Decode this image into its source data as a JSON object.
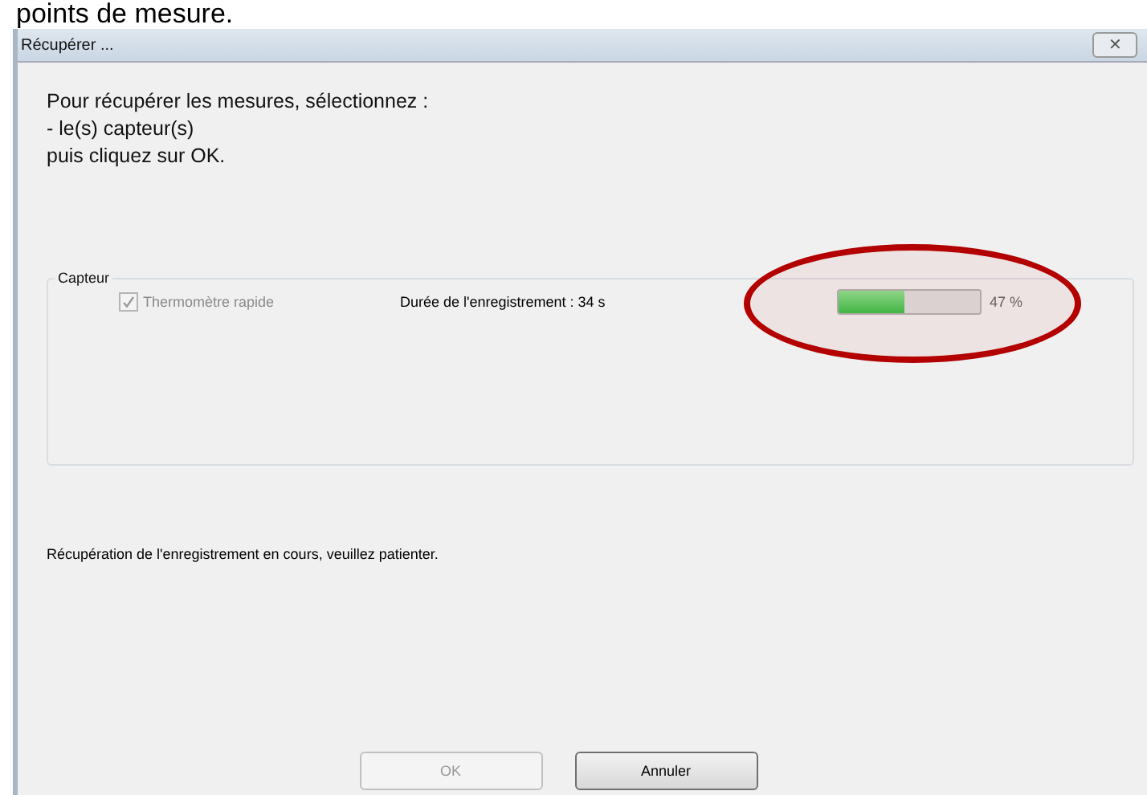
{
  "heading": "points de mesure.",
  "window": {
    "title": "Récupérer ...",
    "close_glyph": "✕"
  },
  "instructions": [
    "Pour récupérer les mesures, sélectionnez :",
    "- le(s) capteur(s)",
    "puis cliquez sur OK."
  ],
  "group": {
    "title": "Capteur",
    "sensors": [
      {
        "label": "Thermomètre rapide",
        "checked": true,
        "disabled": true,
        "duration": "Durée de l'enregistrement : 34 s",
        "level": 0.47,
        "reading": "47 %"
      }
    ]
  },
  "status": "Récupération de l'enregistrement en cours, veuillez patienter.",
  "buttons": [
    {
      "label": "OK",
      "disabled": true
    },
    {
      "label": "Annuler",
      "disabled": false
    }
  ]
}
